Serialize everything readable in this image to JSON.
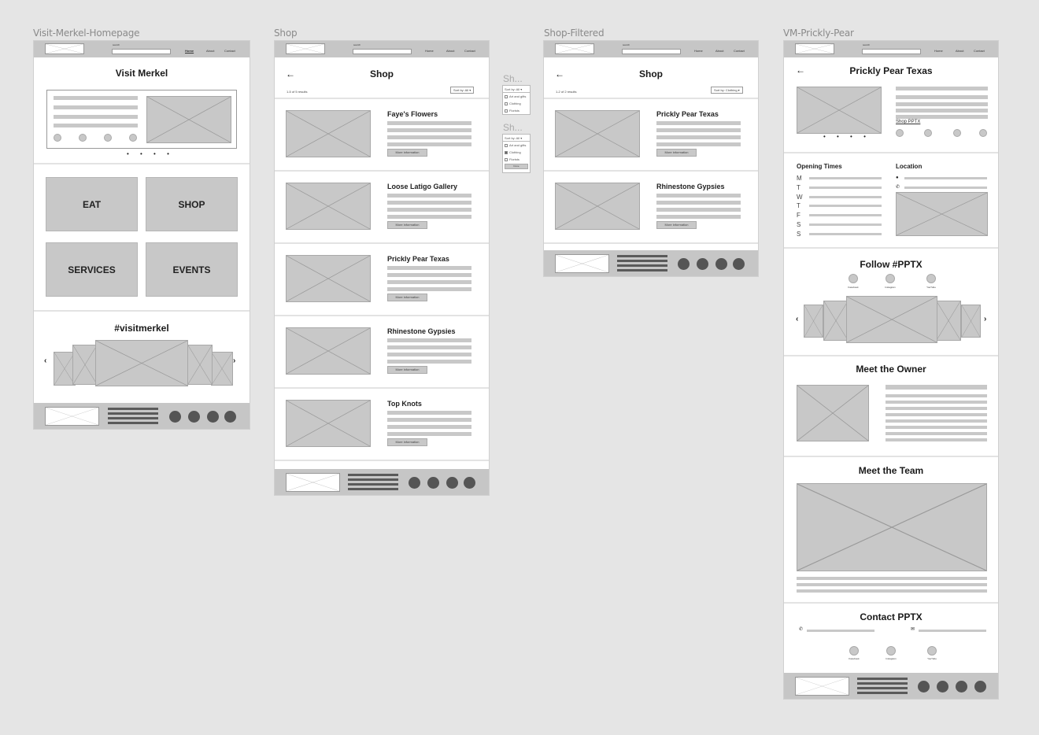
{
  "colors": {
    "canvas": "#e5e5e5",
    "header": "#c6c6c6",
    "placeholder": "#c8c8c8",
    "footer_icon": "#555555"
  },
  "header": {
    "search_label": "search",
    "nav": [
      "Home",
      "About",
      "Contact"
    ]
  },
  "frames": {
    "home": {
      "label": "Visit-Merkel-Homepage",
      "title": "Visit Merkel",
      "hero_dots": "• • • •",
      "tiles": [
        "EAT",
        "SHOP",
        "SERVICES",
        "EVENTS"
      ],
      "social_title": "#visitmerkel",
      "prev": "‹",
      "next": "›"
    },
    "shop": {
      "label": "Shop",
      "title": "Shop",
      "back": "←",
      "result_count": "1-5 of 5 results",
      "sort": "Sort by: All ▾",
      "more_label": "More information",
      "items": [
        "Faye's Flowers",
        "Loose Latigo Gallery",
        "Prickly Pear Texas",
        "Rhinestone Gypsies",
        "Top Knots"
      ]
    },
    "dropdowns": [
      {
        "label": "Sh...",
        "sort": "Sort by: All ▾",
        "options": [
          {
            "label": "Art and gifts",
            "checked": false
          },
          {
            "label": "Clothing",
            "checked": false
          },
          {
            "label": "Florists",
            "checked": false
          }
        ]
      },
      {
        "label": "Sh...",
        "sort": "Sort by: All ▾",
        "options": [
          {
            "label": "Art and gifts",
            "checked": false
          },
          {
            "label": "Clothing",
            "checked": true
          },
          {
            "label": "Florists",
            "checked": false
          }
        ],
        "button": "Done"
      }
    ],
    "shop_filtered": {
      "label": "Shop-Filtered",
      "title": "Shop",
      "back": "←",
      "result_count": "1-2 of 2 results",
      "sort": "Sort by: Clothing ▾",
      "more_label": "More information",
      "items": [
        "Prickly Pear Texas",
        "Rhinestone Gypsies"
      ]
    },
    "prickly": {
      "label": "VM-Prickly-Pear",
      "title": "Prickly Pear Texas",
      "back": "←",
      "shop_link": "Shop PPTX",
      "dots": "• • • •",
      "opening_times_title": "Opening Times",
      "days": [
        "M",
        "T",
        "W",
        "T",
        "F",
        "S",
        "S"
      ],
      "location_title": "Location",
      "location_pin_icon": "📍",
      "phone_icon": "✆",
      "follow_title": "Follow #PPTX",
      "socials": [
        "Facebook",
        "Instagram",
        "YouTube"
      ],
      "prev": "‹",
      "next": "›",
      "owner_title": "Meet the Owner",
      "team_title": "Meet the Team",
      "contact_title": "Contact PPTX",
      "mail_icon": "✉"
    }
  }
}
